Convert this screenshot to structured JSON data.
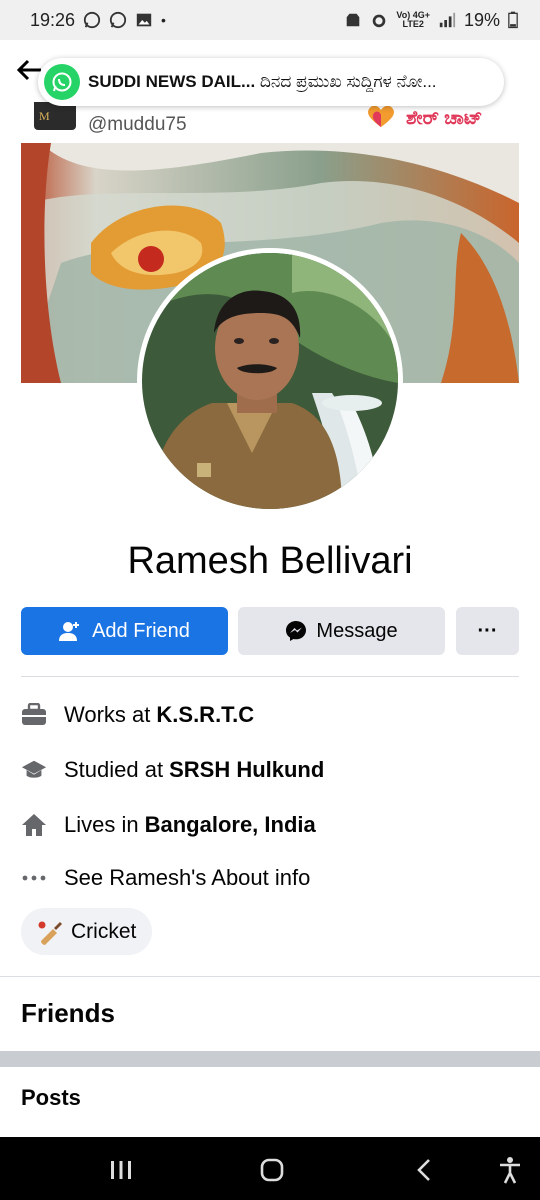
{
  "status_bar": {
    "time": "19:26",
    "network_label_top": "Vo) 4G+",
    "network_label_bottom": "LTE2",
    "battery": "19%"
  },
  "notification": {
    "app_icon": "whatsapp-icon",
    "sender": "SUDDI NEWS DAIL...",
    "preview": "ದಿನದ ಪ್ರಮುಖ ಸುದ್ದಿಗಳ ನೋ..."
  },
  "shared_post": {
    "handle": "@muddu75",
    "brand": "ಶೇರ್ ಚಾಟ್",
    "avatar_letter": "M"
  },
  "profile": {
    "name": "Ramesh Bellivari"
  },
  "actions": {
    "add_friend": "Add Friend",
    "message": "Message",
    "more": "···"
  },
  "info": {
    "work_prefix": "Works at",
    "work_value": "K.S.R.T.C",
    "study_prefix": "Studied at",
    "study_value": "SRSH Hulkund",
    "lives_prefix": "Lives in",
    "lives_value": "Bangalore, India",
    "about": "See Ramesh's About info"
  },
  "interests": {
    "chip": "Cricket"
  },
  "sections": {
    "friends": "Friends",
    "posts": "Posts"
  },
  "colors": {
    "primary_blue": "#1b74e4",
    "secondary_button": "#e4e6eb",
    "whatsapp_green": "#25d366"
  }
}
